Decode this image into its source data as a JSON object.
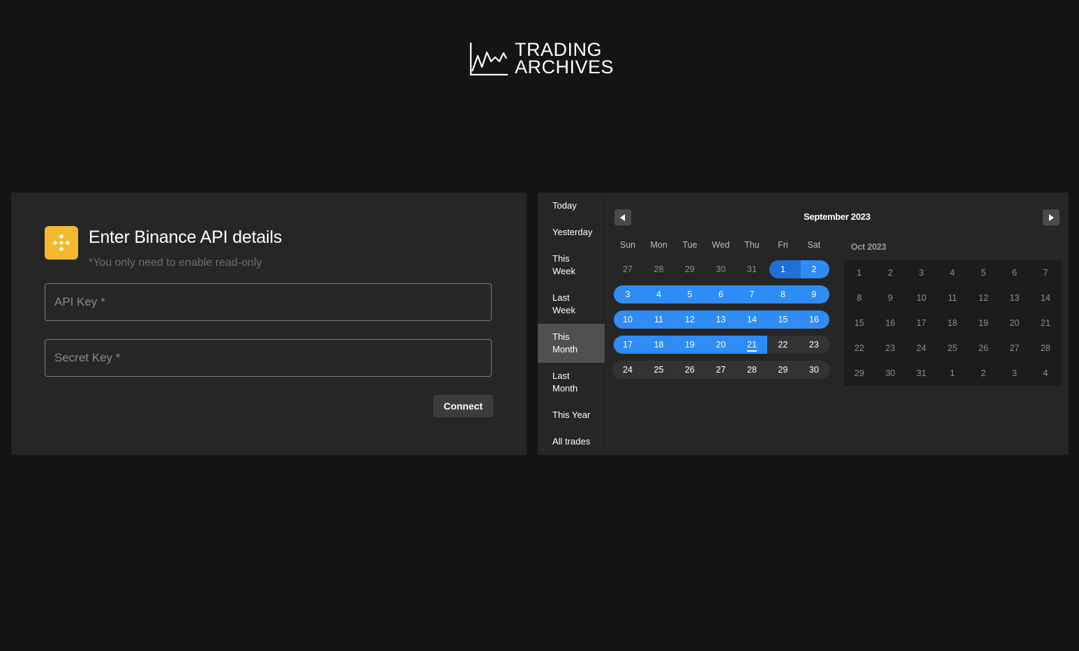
{
  "logo": {
    "line1": "TRADING",
    "line2": "ARCHIVES",
    "icon": "line-chart-icon"
  },
  "api_form": {
    "title": "Enter Binance API details",
    "subtitle": "*You only need to enable read-only",
    "api_key_placeholder": "API Key *",
    "secret_key_placeholder": "Secret Key *",
    "connect_label": "Connect",
    "brand_icon": "binance-icon",
    "brand_color": "#F3BA2F"
  },
  "ranges": [
    {
      "label": "Today"
    },
    {
      "label": "Yesterday"
    },
    {
      "label": "This\nWeek"
    },
    {
      "label": "Last\nWeek"
    },
    {
      "label": "This\nMonth",
      "active": true
    },
    {
      "label": "Last\nMonth"
    },
    {
      "label": "This Year"
    },
    {
      "label": "All trades"
    }
  ],
  "calendar": {
    "title": "September 2023",
    "weekdays": [
      "Sun",
      "Mon",
      "Tue",
      "Wed",
      "Thu",
      "Fri",
      "Sat"
    ],
    "weeks": [
      [
        "27",
        "28",
        "29",
        "30",
        "31",
        "1",
        "2"
      ],
      [
        "3",
        "4",
        "5",
        "6",
        "7",
        "8",
        "9"
      ],
      [
        "10",
        "11",
        "12",
        "13",
        "14",
        "15",
        "16"
      ],
      [
        "17",
        "18",
        "19",
        "20",
        "21",
        "22",
        "23"
      ],
      [
        "24",
        "25",
        "26",
        "27",
        "28",
        "29",
        "30"
      ]
    ],
    "selected_range": [
      "1",
      "21"
    ],
    "today": "21",
    "accent_color": "#2f8cf5",
    "prev_icon": "chevron-left-icon",
    "next_icon": "chevron-right-icon"
  },
  "next_month": {
    "title": "Oct 2023",
    "weeks": [
      [
        "1",
        "2",
        "3",
        "4",
        "5",
        "6",
        "7"
      ],
      [
        "8",
        "9",
        "10",
        "11",
        "12",
        "13",
        "14"
      ],
      [
        "15",
        "16",
        "17",
        "18",
        "19",
        "20",
        "21"
      ],
      [
        "22",
        "23",
        "24",
        "25",
        "26",
        "27",
        "28"
      ],
      [
        "29",
        "30",
        "31",
        "1",
        "2",
        "3",
        "4"
      ]
    ]
  }
}
